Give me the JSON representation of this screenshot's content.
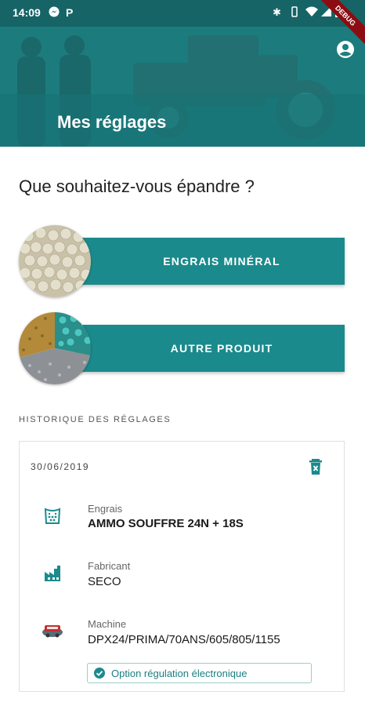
{
  "status_bar": {
    "time": "14:09",
    "left_icons": [
      "messenger-icon",
      "parking-icon"
    ],
    "right_icons": [
      "bluetooth-icon",
      "vibrate-icon",
      "wifi-icon",
      "signal-icon",
      "battery-icon"
    ],
    "debug_banner": "DEBUG"
  },
  "header": {
    "title": "Mes réglages",
    "background_color": "#1f7f81",
    "account_icon": "account-circle-icon"
  },
  "main": {
    "question": "Que souhaitez-vous épandre ?",
    "products": [
      {
        "label": "ENGRAIS MINÉRAL",
        "image": "fertilizer-granules-image"
      },
      {
        "label": "AUTRE PRODUIT",
        "image": "mixed-products-image"
      }
    ],
    "accent_color": "#1b8a8c"
  },
  "history": {
    "section_title": "HISTORIQUE DES RÉGLAGES",
    "entries": [
      {
        "date": "30/06/2019",
        "delete_icon": "trash-icon",
        "rows": [
          {
            "icon": "fertilizer-bag-icon",
            "label": "Engrais",
            "value": "AMMO SOUFFRE 24N + 18S"
          },
          {
            "icon": "factory-icon",
            "label": "Fabricant",
            "value": "SECO"
          },
          {
            "icon": "spreader-machine-icon",
            "label": "Machine",
            "value": "DPX24/PRIMA/70ANS/605/805/1155"
          }
        ],
        "option": {
          "icon": "check-circle-icon",
          "label": "Option régulation électronique"
        }
      }
    ]
  }
}
